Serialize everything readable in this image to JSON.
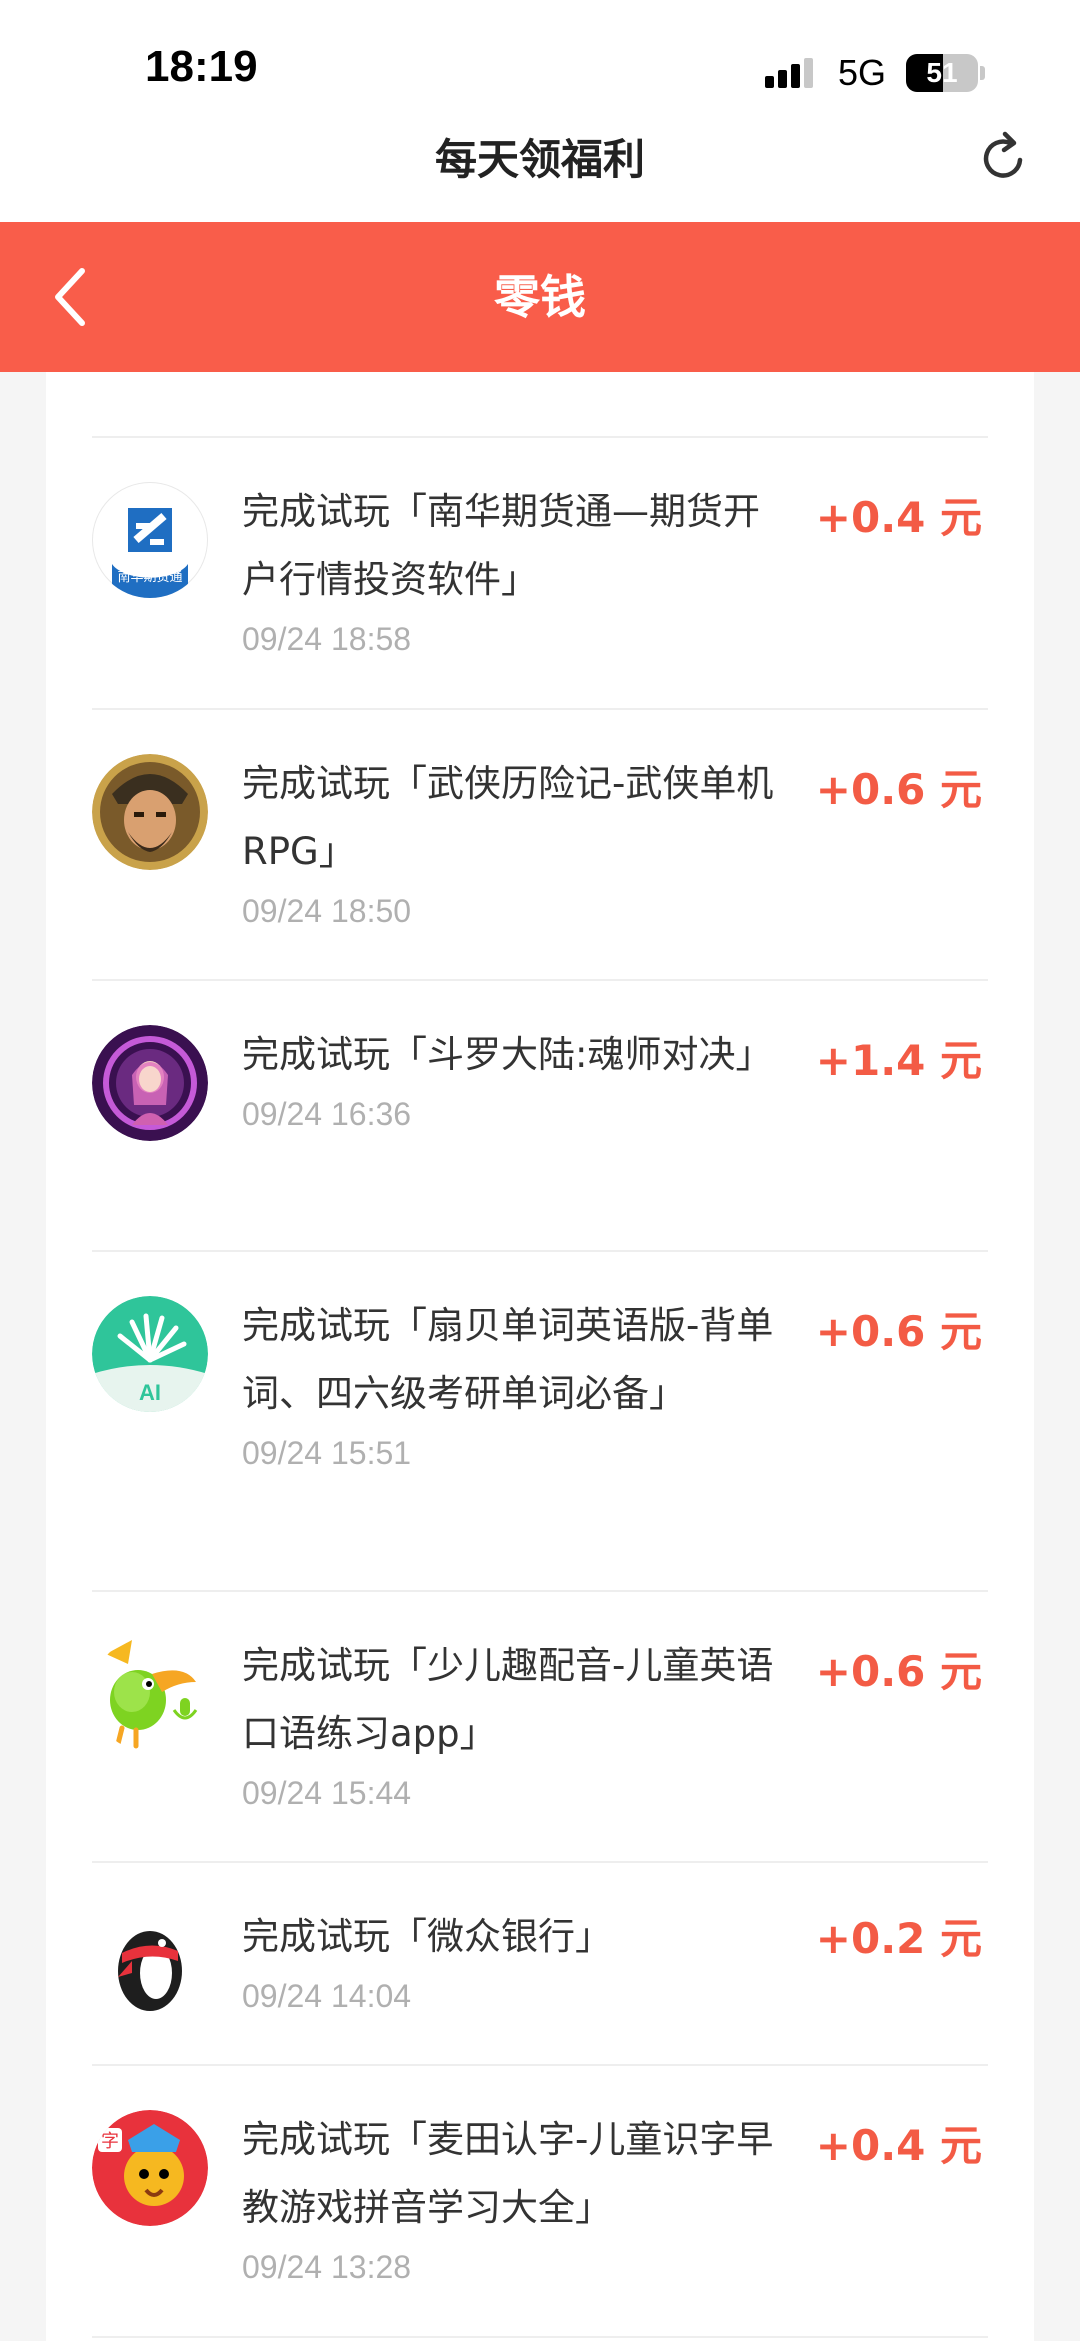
{
  "status_bar": {
    "time": "18:19",
    "network": "5G",
    "battery_percent": "51",
    "battery_level": 0.51
  },
  "top_bar": {
    "title": "每天领福利",
    "refresh_icon": "refresh-icon"
  },
  "header": {
    "back_icon": "chevron-left-icon",
    "title": "零钱",
    "color": "#f95d4a"
  },
  "records": [
    {
      "title": "完成试玩「南华期货通—期货开户行情投资软件」",
      "time": "09/24 18:58",
      "amount": "+0.4 元",
      "icon": "nanhua-futures-app-icon",
      "icon_text": "南华期货通"
    },
    {
      "title": "完成试玩「武侠历险记-武侠单机RPG」",
      "time": "09/24 18:50",
      "amount": "+0.6 元",
      "icon": "wuxia-adventure-app-icon"
    },
    {
      "title": "完成试玩「斗罗大陆:魂师对决」",
      "time": "09/24 16:36",
      "amount": "+1.4 元",
      "icon": "douluo-dalu-app-icon"
    },
    {
      "title": "完成试玩「扇贝单词英语版-背单词、四六级考研单词必备」",
      "time": "09/24 15:51",
      "amount": "+0.6 元",
      "icon": "shanbay-words-app-icon",
      "icon_text": "AI"
    },
    {
      "title": "完成试玩「少儿趣配音-儿童英语口语练习app」",
      "time": "09/24 15:44",
      "amount": "+0.6 元",
      "icon": "parrot-dubbing-app-icon"
    },
    {
      "title": "完成试玩「微众银行」",
      "time": "09/24 14:04",
      "amount": "+0.2 元",
      "icon": "webank-penguin-app-icon"
    },
    {
      "title": "完成试玩「麦田认字-儿童识字早教游戏拼音学习大全」",
      "time": "09/24 13:28",
      "amount": "+0.4 元",
      "icon": "maitian-literacy-app-icon",
      "icon_text": "字"
    }
  ],
  "colors": {
    "amount": "#f35b45",
    "time": "#b0b0b0",
    "background": "#f5f5f5"
  }
}
